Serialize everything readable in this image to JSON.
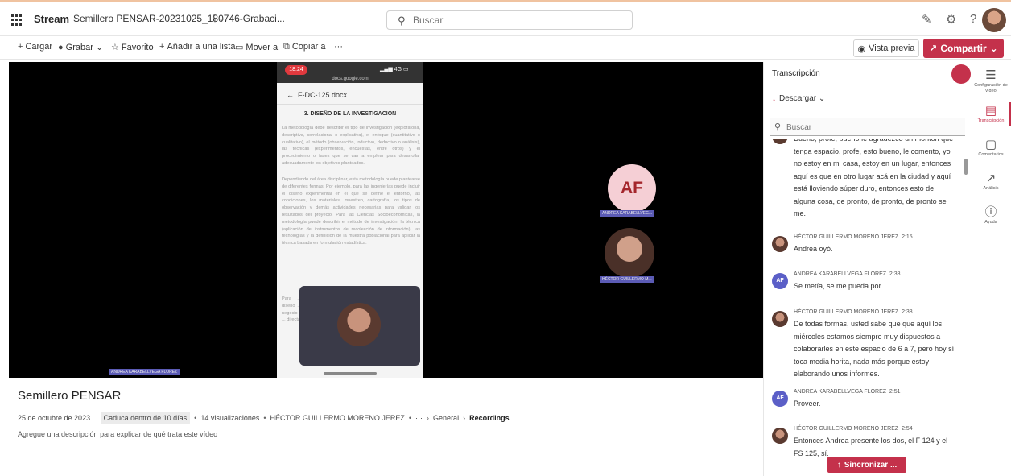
{
  "topbar": {
    "app_name": "Stream",
    "file_title": "Semillero PENSAR-20231025_180746-Grabaci...",
    "title_chevron": "⌄",
    "search_placeholder": "Buscar",
    "icons": [
      "pen-icon",
      "gear-icon",
      "help-icon",
      "avatar"
    ]
  },
  "commands": {
    "upload": "Cargar",
    "record": "Grabar",
    "favorite": "Favorito",
    "add_list": "Añadir a una lista",
    "move": "Mover a",
    "copy": "Copiar a",
    "more": "···",
    "preview": "Vista previa",
    "share": "Compartir"
  },
  "video": {
    "phone": {
      "time": "18:24",
      "network": "4G",
      "url": "docs.google.com",
      "doc_name": "F-DC-125.docx",
      "heading": "3. DISEÑO DE LA INVESTIGACION",
      "paragraph1": "La metodología debe describir el tipo de investigación (exploratoria, descriptiva, correlacional o explicativa), el enfoque (cuantitativo o cualitativo), el método (observación, inductivo, deductivo o análisis), las técnicas (experimentos, encuestas, entre otros) y el procedimiento o fases que se van a emplear para desarrollar adecuadamente los objetivos planteados.",
      "paragraph2": "Dependiendo del área disciplinar, esta metodología puede plantearse de diferentes formas. Por ejemplo, para las ingenierías puede incluir el diseño experimental en el que se define el entorno, las condiciones, los materiales, muestreo, cartografía, los tipos de observación y demás actividades necesarias para validar los resultados del proyecto. Para las Ciencias Socioeconómicas, la metodología puede describir el método de investigación, la técnica (aplicación de instrumentos de recolección de información), las tecnologías y la definición de la muestra poblacional para aplicar la técnica basada en formulación estadística.",
      "paragraph3": "Para ... diseño ... negocio ... directa"
    },
    "participants": {
      "af_initials": "AF",
      "af_name": "ANDREA KARABELLVEG...",
      "hg_name": "HÉCTOR GUILLERMO M...",
      "presenter_name": "ANDREA KARABELLVEGA FLOREZ"
    }
  },
  "details": {
    "title": "Semillero PENSAR",
    "date": "25 de octubre de 2023",
    "expires": "Caduca dentro de 10 días",
    "views": "14 visualizaciones",
    "owner": "HÉCTOR GUILLERMO MORENO JEREZ",
    "crumb_more": "···",
    "crumb_general": "General",
    "crumb_recordings": "Recordings",
    "description": "Agregue una descripción para explicar de qué trata este vídeo"
  },
  "transcript": {
    "title": "Transcripción",
    "download": "Descargar",
    "search_placeholder": "Buscar",
    "sync": "Sincronizar ...",
    "entries": [
      {
        "speaker": "",
        "time": "",
        "initials": "",
        "kind": "hg",
        "text": "Bueno, profe, bueno le agradezco un montón que tenga espacio, profe, esto bueno, le comento, yo no estoy en mi casa, estoy en un lugar, entonces aquí es que en otro lugar acá en la ciudad y aquí está lloviendo súper duro, entonces esto de alguna cosa, de pronto, de pronto, de pronto se me."
      },
      {
        "speaker": "HÉCTOR GUILLERMO MORENO JEREZ",
        "time": "2:15",
        "initials": "",
        "kind": "hg",
        "text": "Andrea oyó."
      },
      {
        "speaker": "ANDREA KARABELLVEGA FLOREZ",
        "time": "2:38",
        "initials": "AF",
        "kind": "af",
        "text": "Se metía, se me pueda por."
      },
      {
        "speaker": "HÉCTOR GUILLERMO MORENO JEREZ",
        "time": "2:38",
        "initials": "",
        "kind": "hg",
        "text": "De todas formas, usted sabe que que aquí los miércoles estamos siempre muy dispuestos a colaborarles en este espacio de 6 a 7, pero hoy sí toca media horita, nada más porque estoy elaborando unos informes."
      },
      {
        "speaker": "ANDREA KARABELLVEGA FLOREZ",
        "time": "2:51",
        "initials": "AF",
        "kind": "af",
        "text": "Proveer."
      },
      {
        "speaker": "HÉCTOR GUILLERMO MORENO JEREZ",
        "time": "2:54",
        "initials": "",
        "kind": "hg",
        "text": "Entonces Andrea presente los dos, el F 124 y el FS 125, sí."
      }
    ]
  },
  "rail": {
    "video_settings": "Configuración de vídeo",
    "transcript": "Transcripción",
    "comments": "Comentarios",
    "analytics": "Análisis",
    "help": "Ayuda"
  },
  "colors": {
    "accent": "#c4314b",
    "af_avatar": "#5b5fc7",
    "af_circle_bg": "#f5cfd5"
  }
}
